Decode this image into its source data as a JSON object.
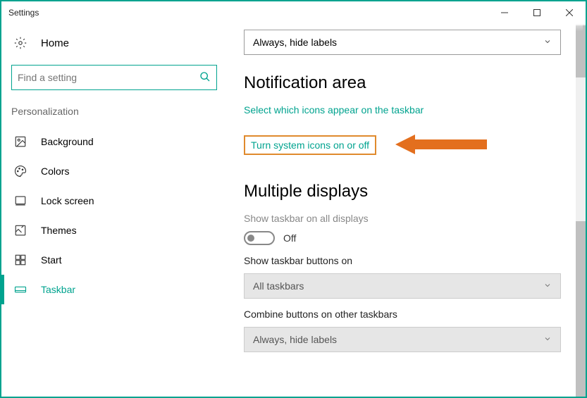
{
  "window": {
    "title": "Settings"
  },
  "sidebar": {
    "home_label": "Home",
    "search_placeholder": "Find a setting",
    "category_label": "Personalization",
    "items": [
      {
        "label": "Background"
      },
      {
        "label": "Colors"
      },
      {
        "label": "Lock screen"
      },
      {
        "label": "Themes"
      },
      {
        "label": "Start"
      },
      {
        "label": "Taskbar"
      }
    ]
  },
  "main": {
    "top_dropdown": {
      "value": "Always, hide labels"
    },
    "notification": {
      "heading": "Notification area",
      "link_icons": "Select which icons appear on the taskbar",
      "link_system": "Turn system icons on or off"
    },
    "multiple": {
      "heading": "Multiple displays",
      "show_all_label": "Show taskbar on all displays",
      "toggle_state": "Off",
      "buttons_on_label": "Show taskbar buttons on",
      "buttons_on_value": "All taskbars",
      "combine_label": "Combine buttons on other taskbars",
      "combine_value": "Always, hide labels"
    }
  }
}
